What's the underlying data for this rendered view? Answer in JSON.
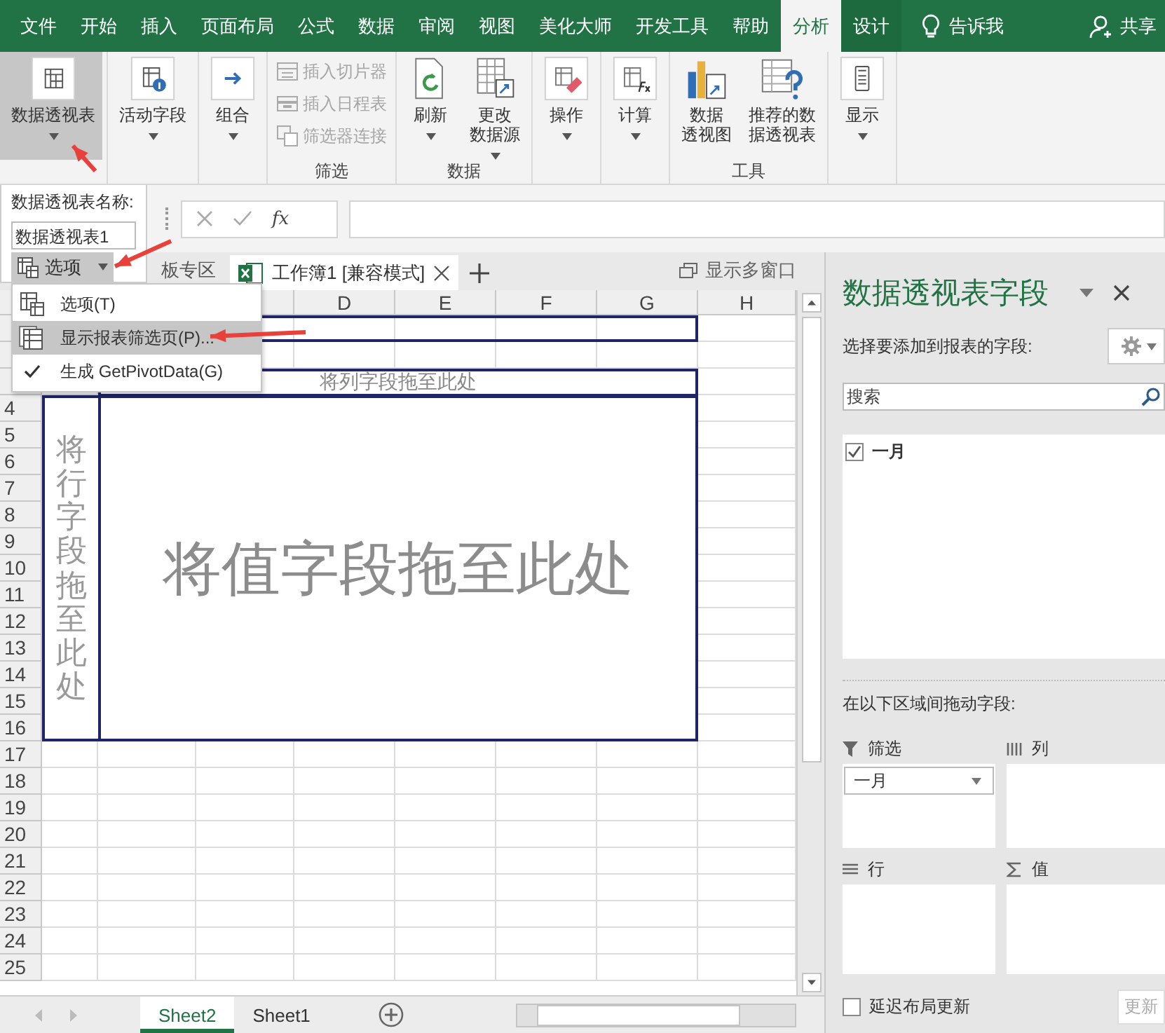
{
  "ribbon_tabs": [
    {
      "label": "文件",
      "kind": "plain",
      "selected": false
    },
    {
      "label": "开始",
      "kind": "plain",
      "selected": false
    },
    {
      "label": "插入",
      "kind": "plain",
      "selected": false
    },
    {
      "label": "页面布局",
      "kind": "plain",
      "selected": false
    },
    {
      "label": "公式",
      "kind": "plain",
      "selected": false
    },
    {
      "label": "数据",
      "kind": "plain",
      "selected": false
    },
    {
      "label": "审阅",
      "kind": "plain",
      "selected": false
    },
    {
      "label": "视图",
      "kind": "plain",
      "selected": false
    },
    {
      "label": "美化大师",
      "kind": "plain",
      "selected": false
    },
    {
      "label": "开发工具",
      "kind": "plain",
      "selected": false
    },
    {
      "label": "帮助",
      "kind": "plain",
      "selected": false
    },
    {
      "label": "分析",
      "kind": "contextual",
      "selected": true
    },
    {
      "label": "设计",
      "kind": "contextual",
      "selected": false
    }
  ],
  "tell_me": "告诉我",
  "share": "共享",
  "ribbon_groups": [
    {
      "buttons": [
        {
          "kind": "large",
          "lines": [
            "数据透视表"
          ],
          "dropdown": true,
          "pressed": true,
          "disabled": false
        }
      ]
    },
    {
      "buttons": [
        {
          "kind": "large",
          "lines": [
            "活动字段"
          ],
          "dropdown": true,
          "pressed": false,
          "disabled": false
        }
      ]
    },
    {
      "buttons": [
        {
          "kind": "large",
          "lines": [
            "组合"
          ],
          "dropdown": true,
          "pressed": false,
          "disabled": false
        }
      ]
    },
    {
      "label": "筛选",
      "buttons": [
        {
          "kind": "small",
          "lines": [
            "插入切片器"
          ],
          "dropdown": false,
          "pressed": false,
          "disabled": true
        },
        {
          "kind": "small",
          "lines": [
            "插入日程表"
          ],
          "dropdown": false,
          "pressed": false,
          "disabled": true
        },
        {
          "kind": "small",
          "lines": [
            "筛选器连接"
          ],
          "dropdown": false,
          "pressed": false,
          "disabled": true
        }
      ]
    },
    {
      "label": "数据",
      "buttons": [
        {
          "kind": "large",
          "lines": [
            "刷新"
          ],
          "dropdown": true,
          "pressed": false,
          "disabled": false
        },
        {
          "kind": "large",
          "lines": [
            "更改",
            "数据源"
          ],
          "dropdown": true,
          "pressed": false,
          "disabled": false
        }
      ]
    },
    {
      "buttons": [
        {
          "kind": "large",
          "lines": [
            "操作"
          ],
          "dropdown": true,
          "pressed": false,
          "disabled": false
        }
      ]
    },
    {
      "buttons": [
        {
          "kind": "large",
          "lines": [
            "计算"
          ],
          "dropdown": true,
          "pressed": false,
          "disabled": false
        }
      ]
    },
    {
      "label": "工具",
      "buttons": [
        {
          "kind": "large",
          "lines": [
            "数据",
            "透视图"
          ],
          "dropdown": false,
          "pressed": false,
          "disabled": false
        },
        {
          "kind": "large",
          "lines": [
            "推荐的数",
            "据透视表"
          ],
          "dropdown": false,
          "pressed": false,
          "disabled": false
        }
      ]
    },
    {
      "buttons": [
        {
          "kind": "large",
          "lines": [
            "显示"
          ],
          "dropdown": true,
          "pressed": false,
          "disabled": false
        }
      ]
    }
  ],
  "pivot_name": {
    "label": "数据透视表名称:",
    "value": "数据透视表1",
    "options_button": "选项"
  },
  "formula_bar": {
    "function_button": "fx"
  },
  "workbook_tabs": {
    "partial_tab": "板专区",
    "document_tab": "工作簿1  [兼容模式]",
    "new_window": "显示多窗口"
  },
  "options_menu": [
    {
      "label": "选项(T)",
      "kind": "icon",
      "checked": false,
      "selected": false
    },
    {
      "label": "显示报表筛选页(P)...",
      "kind": "icon",
      "checked": false,
      "selected": true
    },
    {
      "label": "生成 GetPivotData(G)",
      "kind": "check",
      "checked": true,
      "selected": false
    }
  ],
  "grid": {
    "columns": [
      "D",
      "E",
      "F",
      "G",
      "H"
    ],
    "rows": [
      "4",
      "5",
      "6",
      "7",
      "8",
      "9",
      "10",
      "11",
      "12",
      "13",
      "14",
      "15",
      "16",
      "17",
      "18",
      "19",
      "20",
      "21",
      "22",
      "23",
      "24",
      "25"
    ]
  },
  "pivot": {
    "column_drop": "将列字段拖至此处",
    "row_drop": "将行字段拖至此处",
    "value_drop": "将值字段拖至此处"
  },
  "sheet_tabs": [
    {
      "label": "Sheet2",
      "selected": true
    },
    {
      "label": "Sheet1",
      "selected": false
    }
  ],
  "field_pane": {
    "title": "数据透视表字段",
    "subtitle": "选择要添加到报表的字段:",
    "search_placeholder": "搜索",
    "fields": [
      {
        "label": "一月",
        "checked": true
      }
    ],
    "areas_caption": "在以下区域间拖动字段:",
    "areas": [
      {
        "label": "筛选",
        "kind": "filter",
        "items": [
          "一月"
        ]
      },
      {
        "label": "列",
        "kind": "columns"
      },
      {
        "label": "行",
        "kind": "rows"
      },
      {
        "label": "值",
        "kind": "values"
      }
    ],
    "defer_update": {
      "label": "延迟布局更新",
      "checked": false
    },
    "update_button": "更新"
  }
}
